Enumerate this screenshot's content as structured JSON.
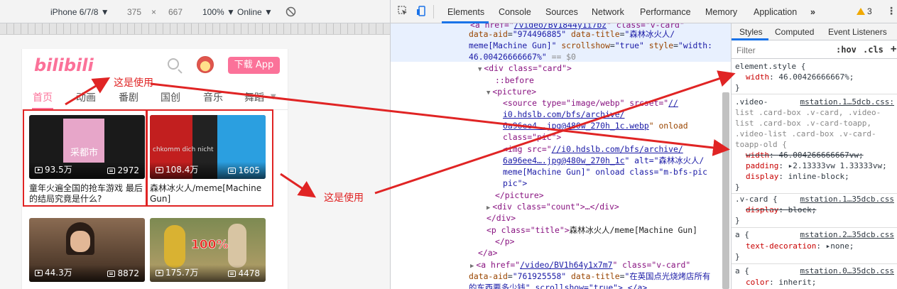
{
  "device_toolbar": {
    "device": "iPhone 6/7/8 ▼",
    "width": "375",
    "times": "×",
    "height": "667",
    "zoom": "100% ▼",
    "throttle": "Online ▼"
  },
  "mobile_page": {
    "logo": "bilibili",
    "download_button": "下载 App",
    "nav_tabs": [
      "首页",
      "动画",
      "番剧",
      "国创",
      "音乐",
      "舞蹈"
    ],
    "videos": [
      {
        "plays": "93.5万",
        "danmaku": "2972",
        "title": "童年火遍全国的抢车游戏 最后的结局究竟是什么?"
      },
      {
        "plays": "108.4万",
        "danmaku": "1605",
        "title": "森林冰火人/meme[Machine Gun]"
      },
      {
        "plays": "44.3万",
        "danmaku": "8872",
        "title": ""
      },
      {
        "plays": "175.7万",
        "danmaku": "4478",
        "title": ""
      }
    ],
    "thumb_overlay_text": [
      "采都市",
      "chkomm dich nicht",
      "100%"
    ]
  },
  "annotations": {
    "label_top": "这是使用",
    "label_right": "这是使用",
    "color": "#e02424"
  },
  "devtools": {
    "tabs": [
      "Elements",
      "Console",
      "Sources",
      "Network",
      "Performance",
      "Memory",
      "Application",
      "»"
    ],
    "warning_count": "3",
    "menu": "⋮",
    "elements": {
      "line1": {
        "pre": "<a href=\"",
        "link": "/video/BV1844y1i7bz",
        "post": "\" class=\"v-card\""
      },
      "line2": {
        "a1": "data-aid",
        "v1": "\"974496885\"",
        "a2": "data-title",
        "v2": "\"森林冰火人/"
      },
      "line3": {
        "v": "meme[Machine Gun]\"",
        "a1": "scrollshow",
        "v1": "\"true\"",
        "a2": "style",
        "v2": "\"width:"
      },
      "line4": {
        "v": "46.00426666667%\"",
        "tail": "== $0"
      },
      "line5": "<div class=\"card\">",
      "line6": "::before",
      "line7": "<picture>",
      "line8": {
        "a": "<source type=\"image/webp\" srcset=\"",
        "link": "//"
      },
      "line9": {
        "link": "i0.hdslb.com/bfs/archive/"
      },
      "line10": {
        "link": "6a96ee4….jpg@480w_270h_1c.webp",
        "post": "\" onload"
      },
      "line11": "class=\"pic\">",
      "line12": {
        "pre": "<img src=\"",
        "link": "//i0.hdslb.com/bfs/archive/"
      },
      "line13": {
        "link": "6a96ee4….jpg@480w_270h_1c",
        "post": "\" alt=\"森林冰火人/"
      },
      "line14": "meme[Machine Gun]\" onload class=\"m-bfs-pic",
      "line15": "pic\">",
      "line16": "</picture>",
      "line17": "<div class=\"count\">…</div>",
      "line18": "</div>",
      "line19": {
        "pre": "<p class=\"title\">",
        "text": "森林冰火人/meme[Machine Gun]"
      },
      "line20": "</p>",
      "line21": "</a>",
      "line22": {
        "pre": "<a href=\"",
        "link": "/video/BV1h64y1x7m7",
        "post": "\" class=\"v-card\""
      },
      "line23": {
        "a1": "data-aid",
        "v1": "\"761925558\"",
        "a2": "data-title",
        "v2": "\"在英国点光烧烤店所有"
      },
      "line24": "的东西要多少钱\" scrollshow=\"true\">…</a>"
    },
    "styles": {
      "tabs": [
        "Styles",
        "Computed",
        "Event Listeners"
      ],
      "filter_placeholder": "Filter",
      "hov": ":hov",
      "cls": ".cls",
      "plus": "+",
      "rule1_selector": "element.style {",
      "rule1_prop": "width",
      "rule1_value": "46.00426666667%;",
      "close": "}",
      "rule2_sel1": ".video-",
      "rule2_src": "mstation.1…5dcb.css:",
      "rule2_sel2": "list .card-box .v-card, .video-",
      "rule2_sel3": "list .card-box .v-card-toapp,",
      "rule2_sel4": ".video-list .card-box .v-card-",
      "rule2_sel5": "toapp-old {",
      "rule2_p1": "width",
      "rule2_v1": "46.004266666667vw;",
      "rule2_p2": "padding",
      "rule2_v2": "2.13333vw 1.33333vw;",
      "rule2_p3": "display",
      "rule2_v3": "inline-block;",
      "rule3_sel": ".v-card {",
      "rule3_src": "mstation.1…35dcb.css",
      "rule3_p": "display",
      "rule3_v": "block;",
      "rule4_sel": "a {",
      "rule4_src": "mstation.2…35dcb.css",
      "rule4_p": "text-decoration",
      "rule4_v": "none;",
      "rule5_sel": "a {",
      "rule5_src": "mstation.0…35dcb.css",
      "rule5_p": "color",
      "rule5_v": "inherit;"
    }
  }
}
